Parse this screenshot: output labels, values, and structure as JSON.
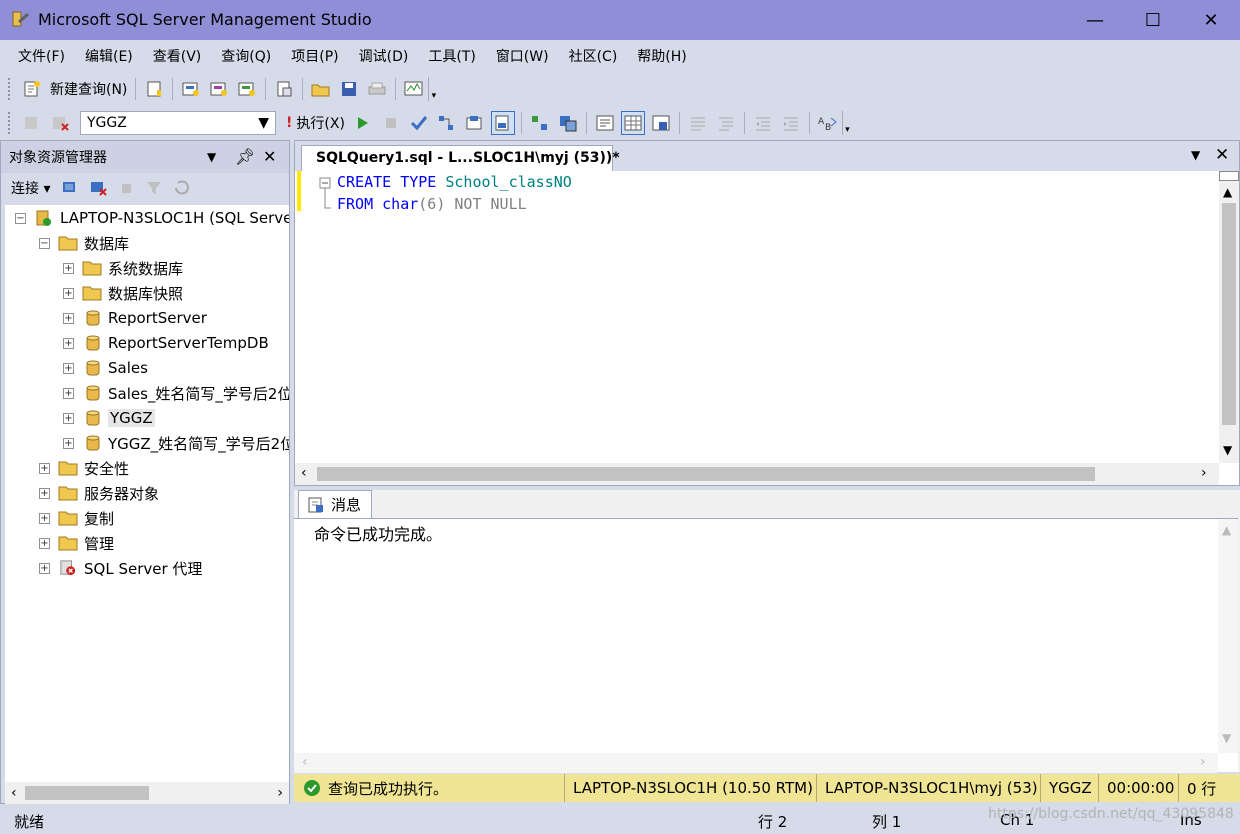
{
  "window": {
    "title": "Microsoft SQL Server Management Studio"
  },
  "menu": [
    "文件(F)",
    "编辑(E)",
    "查看(V)",
    "查询(Q)",
    "项目(P)",
    "调试(D)",
    "工具(T)",
    "窗口(W)",
    "社区(C)",
    "帮助(H)"
  ],
  "toolbar1": {
    "new_query": "新建查询(N)"
  },
  "toolbar2": {
    "database": "YGGZ",
    "execute": "执行(X)"
  },
  "object_explorer": {
    "title": "对象资源管理器",
    "connect": "连接",
    "server": "LAPTOP-N3SLOC1H (SQL Serve",
    "databases_folder": "数据库",
    "db_items": [
      "系统数据库",
      "数据库快照",
      "ReportServer",
      "ReportServerTempDB",
      "Sales",
      "Sales_姓名简写_学号后2位",
      "YGGZ",
      "YGGZ_姓名简写_学号后2位"
    ],
    "other_folders": [
      "安全性",
      "服务器对象",
      "复制",
      "管理",
      "SQL Server 代理"
    ]
  },
  "editor": {
    "tab_title": "SQLQuery1.sql - L...SLOC1H\\myj (53))*",
    "line1": {
      "kw": "CREATE TYPE",
      "name": "School_classNO"
    },
    "line2": {
      "kw1": "FROM",
      "type": "char",
      "args": "(6)",
      "rest": "NOT NULL"
    }
  },
  "results": {
    "tab": "消息",
    "message": "命令已成功完成。"
  },
  "query_status": {
    "status": "查询已成功执行。",
    "server": "LAPTOP-N3SLOC1H (10.50 RTM)",
    "user": "LAPTOP-N3SLOC1H\\myj (53)",
    "database": "YGGZ",
    "elapsed": "00:00:00",
    "rows": "0 行"
  },
  "status_bar": {
    "ready": "就绪",
    "line": "行 2",
    "col": "列 1",
    "ch": "Ch 1",
    "ins": "Ins"
  },
  "watermark": "https://blog.csdn.net/qq_43095848"
}
